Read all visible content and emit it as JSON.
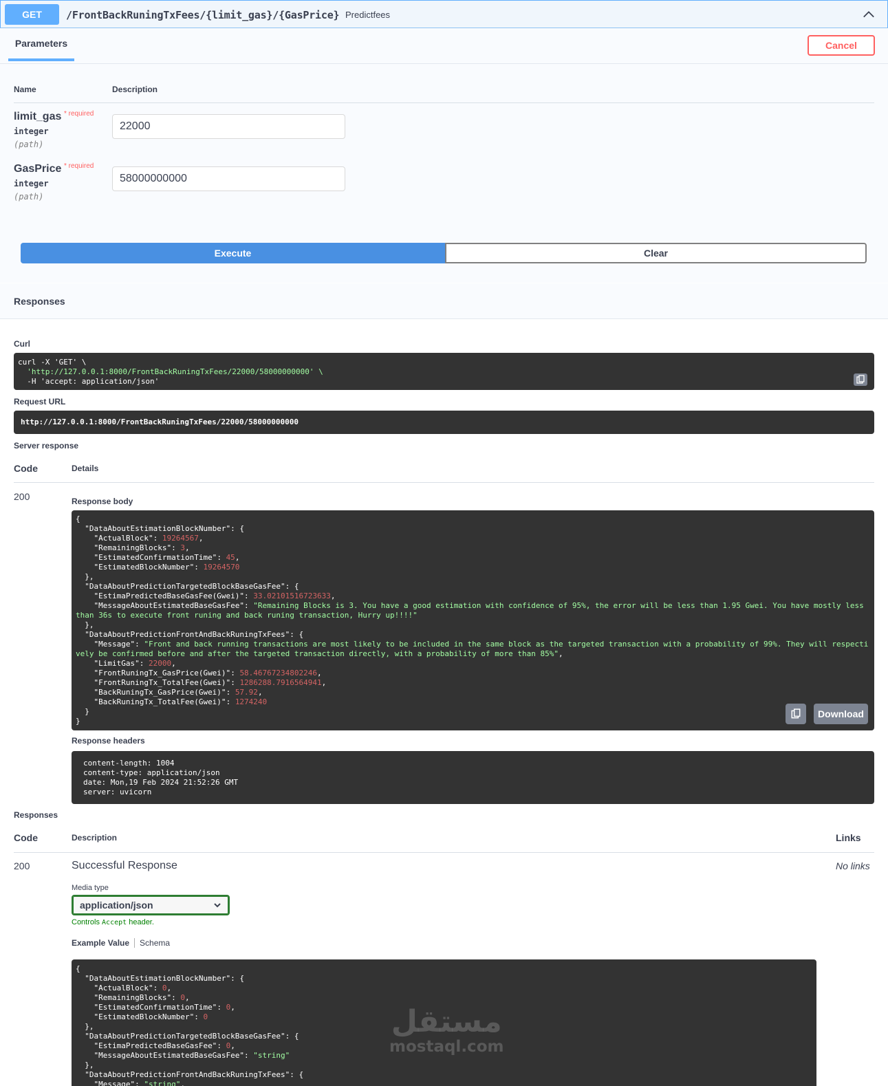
{
  "operation": {
    "method": "GET",
    "path": "/FrontBackRuningTxFees/{limit_gas}/{GasPrice}",
    "summary": "Predictfees"
  },
  "parameters": {
    "tab_label": "Parameters",
    "cancel_label": "Cancel",
    "col_name": "Name",
    "col_description": "Description",
    "items": [
      {
        "name": "limit_gas",
        "required": "* required",
        "type": "integer",
        "in": "(path)",
        "value": "22000"
      },
      {
        "name": "GasPrice",
        "required": "* required",
        "type": "integer",
        "in": "(path)",
        "value": "58000000000"
      }
    ],
    "execute_label": "Execute",
    "clear_label": "Clear"
  },
  "responses_section": {
    "title": "Responses",
    "curl_label": "Curl",
    "curl_lines": [
      "curl -X 'GET' \\",
      "'http://127.0.0.1:8000/FrontBackRuningTxFees/22000/58000000000' \\",
      "-H 'accept: application/json'"
    ],
    "request_url_label": "Request URL",
    "request_url": "http://127.0.0.1:8000/FrontBackRuningTxFees/22000/58000000000",
    "server_response_label": "Server response",
    "col_code": "Code",
    "col_details": "Details",
    "status_code": "200",
    "response_body_label": "Response body",
    "response_body": {
      "k1": "\"DataAboutEstimationBlockNumber\"",
      "k_actual": "\"ActualBlock\"",
      "v_actual": "19264567",
      "k_remaining": "\"RemainingBlocks\"",
      "v_remaining": "3",
      "k_time": "\"EstimatedConfirmationTime\"",
      "v_time": "45",
      "k_block": "\"EstimatedBlockNumber\"",
      "v_block": "19264570",
      "k2": "\"DataAboutPredictionTargetedBlockBaseGasFee\"",
      "k_pred": "\"EstimaPredictedBaseGasFee(Gwei)\"",
      "v_pred": "33.02101516723633",
      "k_msg": "\"MessageAboutEstimatedBaseGasFee\"",
      "v_msg": "\"Remaining Blocks is 3. You have a good estimation with confidence of 95%, the error will be less than 1.95 Gwei. You have mostly less than 36s to execute front runing and back runing transaction, Hurry up!!!!\"",
      "k3": "\"DataAboutPredictionFrontAndBackRuningTxFees\"",
      "k_message": "\"Message\"",
      "v_message": "\"Front and back running transactions are most likely to be included in the same block as the targeted transaction with a probability of 99%. They will respectively be confirmed before and after the targeted transaction directly, with a probability of more than 85%\"",
      "k_limit": "\"LimitGas\"",
      "v_limit": "22000",
      "k_fgp": "\"FrontRuningTx_GasPrice(Gwei)\"",
      "v_fgp": "58.46767234802246",
      "k_ftf": "\"FrontRuningTx_TotalFee(Gwei)\"",
      "v_ftf": "1286288.7916564941",
      "k_bgp": "\"BackRuningTx_GasPrice(Gwei)\"",
      "v_bgp": "57.92",
      "k_btf": "\"BackRuningTx_TotalFee(Gwei)\"",
      "v_btf": "1274240"
    },
    "download_label": "Download",
    "response_headers_label": "Response headers",
    "response_headers": [
      "content-length: 1004",
      "content-type: application/json",
      "date: Mon,19 Feb 2024 21:52:26 GMT",
      "server: uvicorn"
    ],
    "responses_label": "Responses",
    "col_description": "Description",
    "col_links": "Links",
    "doc_code": "200",
    "doc_description": "Successful Response",
    "no_links": "No links",
    "media_type_label": "Media type",
    "media_type_value": "application/json",
    "controls_prefix": "Controls",
    "controls_code": "Accept",
    "controls_suffix": "header.",
    "example_tab": "Example Value",
    "schema_tab": "Schema",
    "example": {
      "k1": "\"DataAboutEstimationBlockNumber\"",
      "k_actual": "\"ActualBlock\"",
      "v_actual": "0",
      "k_remaining": "\"RemainingBlocks\"",
      "v_remaining": "0",
      "k_time": "\"EstimatedConfirmationTime\"",
      "v_time": "0",
      "k_block": "\"EstimatedBlockNumber\"",
      "v_block": "0",
      "k2": "\"DataAboutPredictionTargetedBlockBaseGasFee\"",
      "k_pred": "\"EstimaPredictedBaseGasFee\"",
      "v_pred": "0",
      "k_msg": "\"MessageAboutEstimatedBaseGasFee\"",
      "v_msg": "\"string\"",
      "k3": "\"DataAboutPredictionFrontAndBackRuningTxFees\"",
      "k_message": "\"Message\"",
      "v_message": "\"string\""
    }
  },
  "watermark": {
    "arabic": "مستقل",
    "latin": "mostaql.com"
  },
  "colors": {
    "get": "#61affe",
    "execute": "#4990e2",
    "cancel": "#ff6060",
    "code_bg": "#333333",
    "string": "#a2fca2",
    "number": "#d36363",
    "media_border": "#2e7d32"
  },
  "icons": [
    "chevron-up-icon",
    "copy-icon",
    "chevron-down-icon"
  ]
}
